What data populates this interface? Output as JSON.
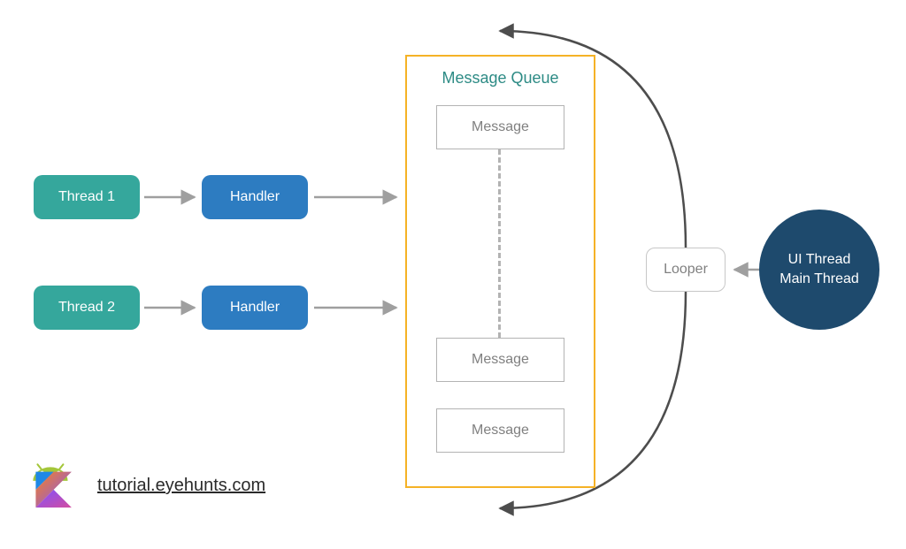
{
  "threads": [
    {
      "label": "Thread 1"
    },
    {
      "label": "Thread 2"
    }
  ],
  "handlers": [
    {
      "label": "Handler"
    },
    {
      "label": "Handler"
    }
  ],
  "message_queue": {
    "title": "Message Queue",
    "messages": [
      {
        "label": "Message"
      },
      {
        "label": "Message"
      },
      {
        "label": "Message"
      }
    ]
  },
  "looper": {
    "label": "Looper"
  },
  "ui_thread": {
    "line1": "UI Thread",
    "line2": "Main Thread"
  },
  "footer": {
    "url": "tutorial.eyehunts.com"
  },
  "colors": {
    "thread_bg": "#35a79c",
    "handler_bg": "#2d7cc1",
    "queue_border": "#f5b226",
    "queue_title": "#2d8b85",
    "box_border": "#b3b3b3",
    "box_text": "#808080",
    "circle_bg": "#1e4a6d",
    "arrow_gray": "#9f9f9f",
    "arrow_dark": "#4d4d4d"
  }
}
